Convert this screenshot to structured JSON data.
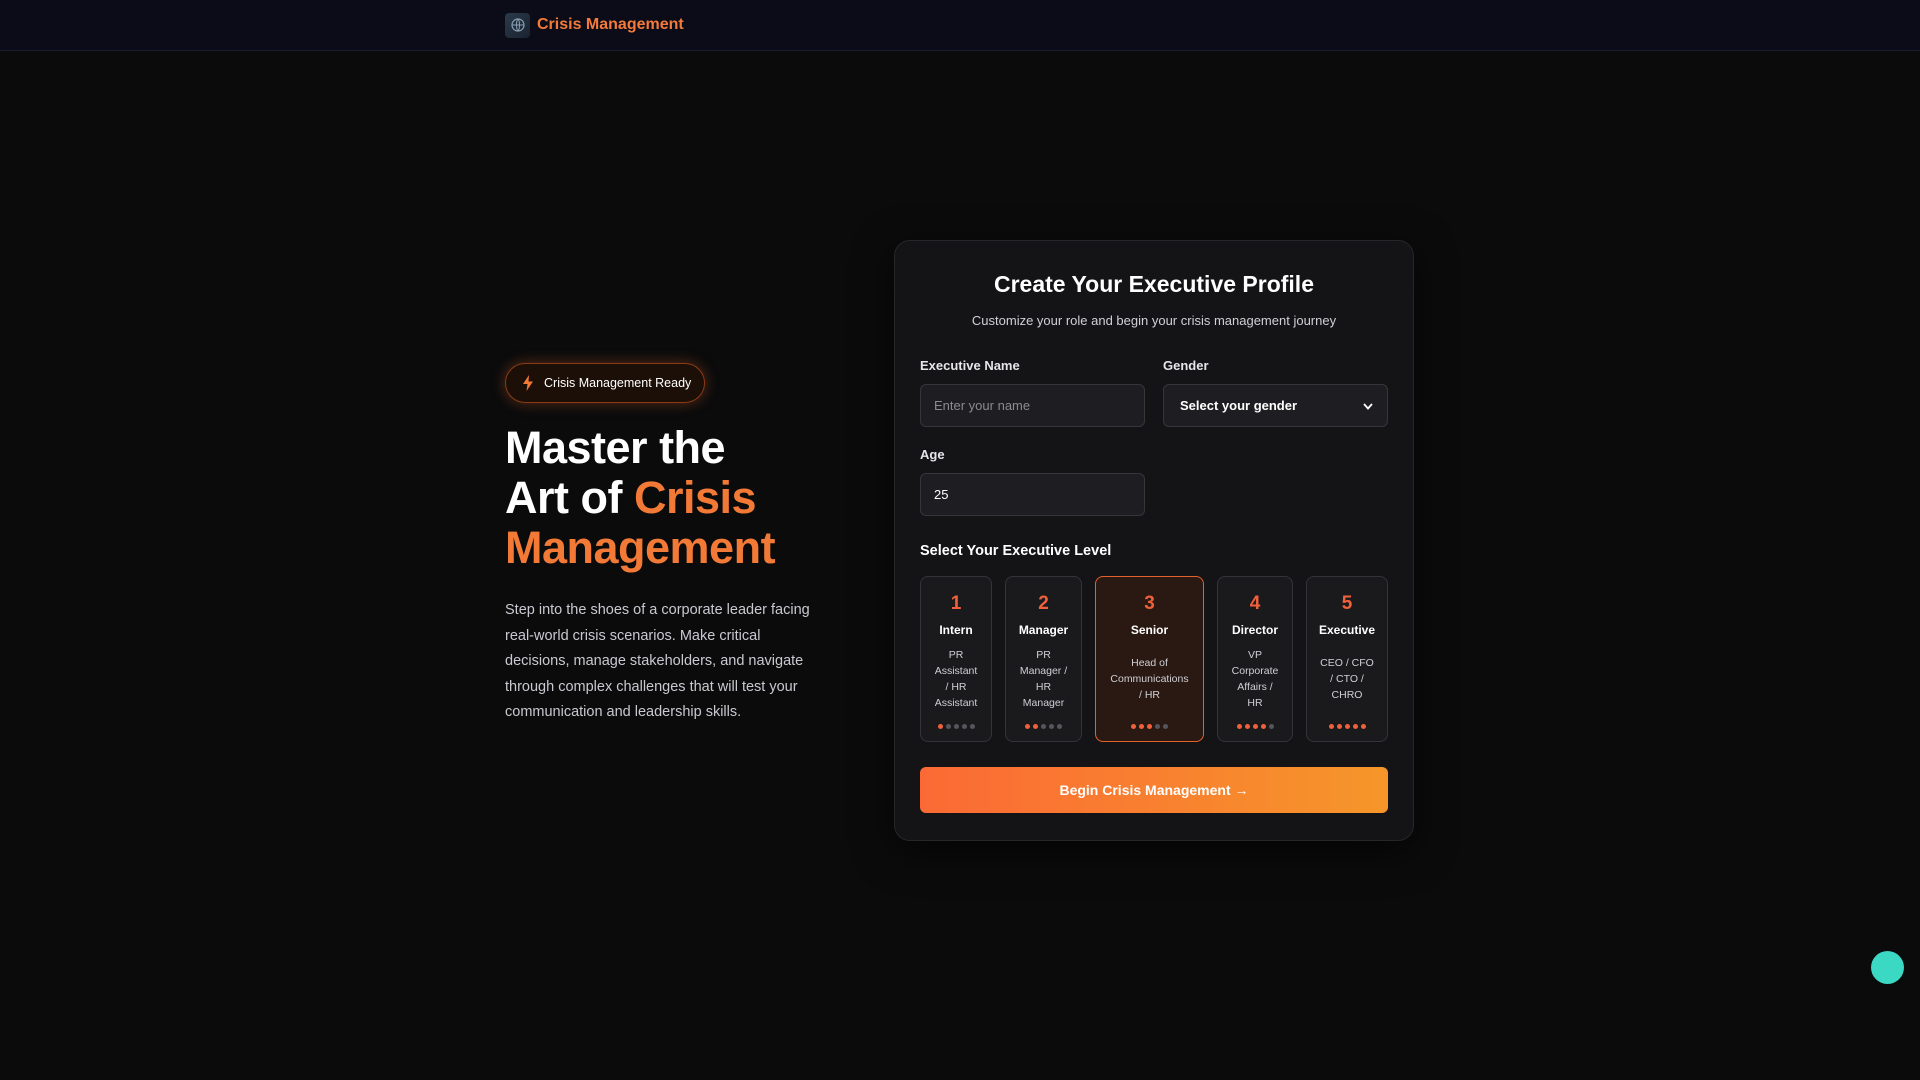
{
  "topbar": {
    "title": "Crisis Management",
    "logo_icon": "globe-logo-icon"
  },
  "hero": {
    "badge": "Crisis Management Ready",
    "badge_icon": "lightning-icon",
    "headline_line1": "Master the",
    "headline_line2_plain": "Art of ",
    "headline_line2_accent": "Crisis",
    "headline_line3_accent": "Management",
    "description": "Step into the shoes of a corporate leader facing real-world crisis scenarios. Make critical decisions, manage stakeholders, and navigate through complex challenges that will test your communication and leadership skills."
  },
  "profile": {
    "title": "Create Your Executive Profile",
    "subtitle": "Customize your role and begin your crisis management journey",
    "name_label": "Executive Name",
    "name_placeholder": "Enter your name",
    "gender_label": "Gender",
    "gender_value": "Select your gender",
    "age_label": "Age",
    "age_value": "25",
    "levels_title": "Select Your Executive Level",
    "levels": [
      {
        "num": "1",
        "name": "Intern",
        "roles": [
          "PR",
          "Assistant",
          "/ HR",
          "Assistant"
        ],
        "level": 1
      },
      {
        "num": "2",
        "name": "Manager",
        "roles": [
          "PR",
          "Manager /",
          "HR",
          "Manager"
        ],
        "level": 2
      },
      {
        "num": "3",
        "name": "Senior",
        "roles": [
          "Head of",
          "Communications",
          "/ HR"
        ],
        "level": 3
      },
      {
        "num": "4",
        "name": "Director",
        "roles": [
          "VP",
          "Corporate",
          "Affairs /",
          "HR"
        ],
        "level": 4
      },
      {
        "num": "5",
        "name": "Executive",
        "roles": [
          "CEO / CFO",
          "/ CTO /",
          "CHRO"
        ],
        "level": 5
      }
    ],
    "selected_level": 3,
    "cta_label": "Begin Crisis Management →"
  },
  "colors": {
    "accent": "#f27a36",
    "level_accent": "#f0603a",
    "fab": "#3bd8c4"
  }
}
